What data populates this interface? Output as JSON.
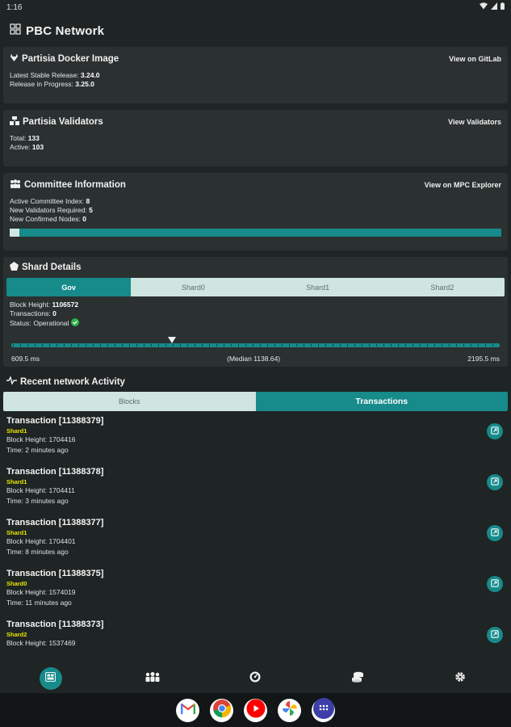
{
  "status_bar": {
    "time": "1:16"
  },
  "app": {
    "title": "PBC Network"
  },
  "docker": {
    "title": "Partisia Docker Image",
    "link": "View on GitLab",
    "stable_label": "Latest Stable Release:",
    "stable_value": "3.24.0",
    "progress_label": "Release in Progress:",
    "progress_value": "3.25.0"
  },
  "validators": {
    "title": "Partisia Validators",
    "link": "View Validators",
    "total_label": "Total:",
    "total_value": "133",
    "active_label": "Active:",
    "active_value": "103"
  },
  "committee": {
    "title": "Committee Information",
    "link": "View on MPC Explorer",
    "index_label": "Active Committee Index:",
    "index_value": "8",
    "required_label": "New Validators Required:",
    "required_value": "5",
    "confirmed_label": "New Confirmed Nodes:",
    "confirmed_value": "0",
    "progress_fraction": 0.02
  },
  "shard": {
    "title": "Shard Details",
    "tabs": [
      "Gov",
      "Shard0",
      "Shard1",
      "Shard2"
    ],
    "active_tab": 0,
    "block_label": "Block Height:",
    "block_value": "1106572",
    "tx_label": "Transactions:",
    "tx_value": "0",
    "status_label": "Status:",
    "status_value": "Operational",
    "slider_min": "609.5 ms",
    "slider_median": "(Median 1138.64)",
    "slider_max": "2195.5 ms",
    "slider_fraction": 0.33
  },
  "activity": {
    "title": "Recent network Activity",
    "tabs": [
      "Blocks",
      "Transactions"
    ],
    "active_tab": 1,
    "transactions": [
      {
        "title": "Transaction [11388379]",
        "shard": "Shard1",
        "block": "Block Height: 1704416",
        "time": "Time: 2 minutes ago"
      },
      {
        "title": "Transaction [11388378]",
        "shard": "Shard1",
        "block": "Block Height: 1704411",
        "time": "Time: 3 minutes ago"
      },
      {
        "title": "Transaction [11388377]",
        "shard": "Shard1",
        "block": "Block Height: 1704401",
        "time": "Time: 8 minutes ago"
      },
      {
        "title": "Transaction [11388375]",
        "shard": "Shard0",
        "block": "Block Height: 1574019",
        "time": "Time: 11 minutes ago"
      },
      {
        "title": "Transaction [11388373]",
        "shard": "Shard2",
        "block": "Block Height: 1537469",
        "time": ""
      }
    ]
  },
  "colors": {
    "accent": "#178a8a",
    "background": "#1f2424",
    "card": "#2b3030",
    "shard_text": "#e6e600",
    "tab_inactive": "#cfe5e2"
  },
  "bottom_nav": [
    "dashboard-icon",
    "people-icon",
    "speedometer-icon",
    "coins-icon",
    "gear-icon"
  ],
  "dock_apps": [
    "gmail-icon",
    "chrome-icon",
    "youtube-icon",
    "photos-icon",
    "app-drawer-icon"
  ]
}
